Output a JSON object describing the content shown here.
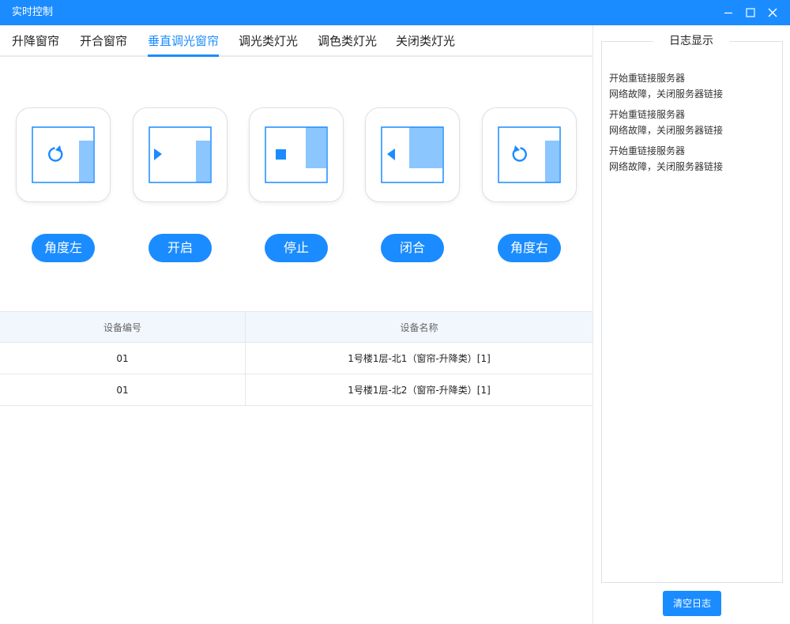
{
  "window": {
    "title": "实时控制"
  },
  "tabs": [
    {
      "label": "升降窗帘",
      "active": false
    },
    {
      "label": "开合窗帘",
      "active": false
    },
    {
      "label": "垂直调光窗帘",
      "active": true
    },
    {
      "label": "调光类灯光",
      "active": false
    },
    {
      "label": "调色类灯光",
      "active": false
    },
    {
      "label": "关闭类灯光",
      "active": false
    }
  ],
  "controls": [
    {
      "label": "角度左",
      "icon": "rotate-cw-icon"
    },
    {
      "label": "开启",
      "icon": "play-left-icon"
    },
    {
      "label": "停止",
      "icon": "stop-icon"
    },
    {
      "label": "闭合",
      "icon": "play-back-icon"
    },
    {
      "label": "角度右",
      "icon": "rotate-ccw-icon"
    }
  ],
  "table": {
    "headers": [
      "设备编号",
      "设备名称"
    ],
    "rows": [
      [
        "01",
        "1号楼1层-北1（窗帘-升降类）[1]"
      ],
      [
        "01",
        "1号楼1层-北2（窗帘-升降类）[1]"
      ]
    ]
  },
  "log": {
    "title": "日志显示",
    "entries": [
      [
        "开始重链接服务器",
        "网络故障，关闭服务器链接"
      ],
      [
        "开始重链接服务器",
        "网络故障，关闭服务器链接"
      ],
      [
        "开始重链接服务器",
        "网络故障，关闭服务器链接"
      ]
    ],
    "clear_label": "清空日志"
  },
  "colors": {
    "accent": "#1a8cff",
    "header_bg": "#f2f7fd",
    "border": "#e4e7ed"
  }
}
